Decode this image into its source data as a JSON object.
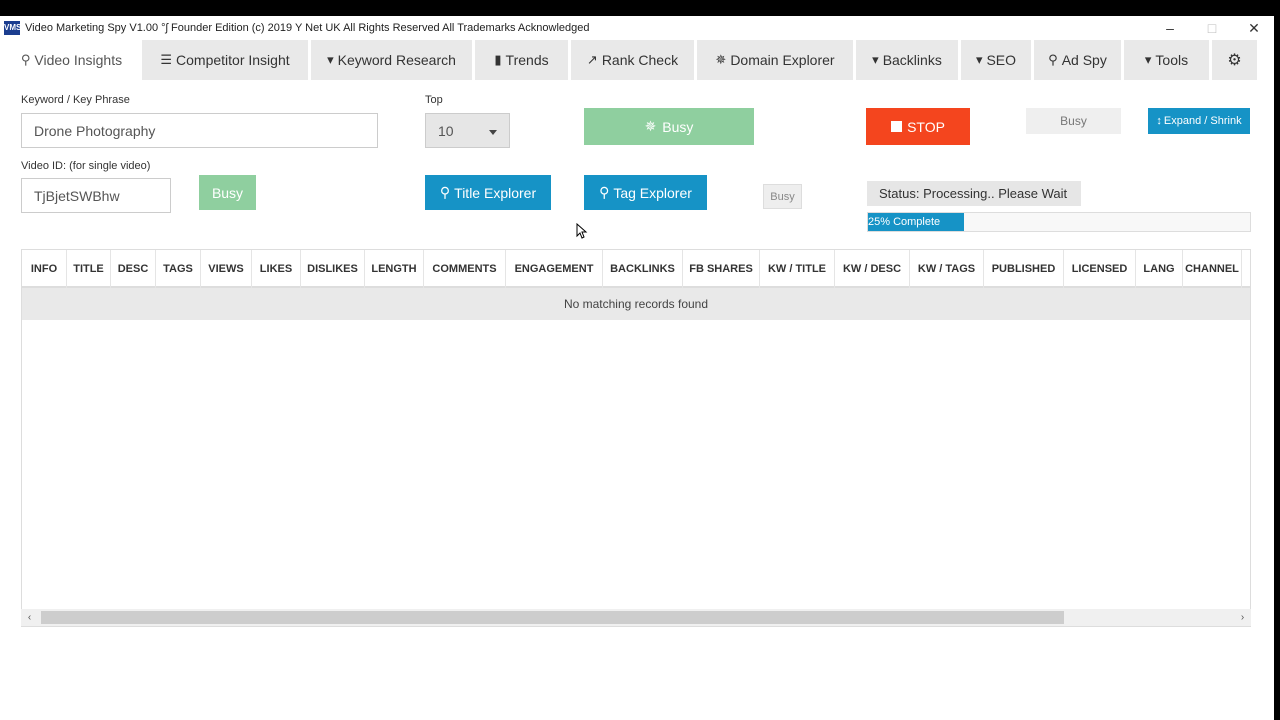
{
  "window": {
    "icon_text": "VMS",
    "title": "Video Marketing Spy V1.00   °ʃ   Founder Edition (c) 2019 Y Net UK   All Rights Reserved   All Trademarks Acknowledged",
    "minimize": "–",
    "maximize": "□",
    "close": "✕"
  },
  "tabs": [
    {
      "label": "Video Insights",
      "icon": "search-icon",
      "glyph": "⚲"
    },
    {
      "label": "Competitor Insight",
      "icon": "list-icon",
      "glyph": "☰"
    },
    {
      "label": "Keyword Research",
      "icon": "caret-icon",
      "glyph": "▾"
    },
    {
      "label": "Trends",
      "icon": "area-chart-icon",
      "glyph": "▮"
    },
    {
      "label": "Rank Check",
      "icon": "line-chart-icon",
      "glyph": "↗"
    },
    {
      "label": "Domain Explorer",
      "icon": "spinner-icon",
      "glyph": "✵"
    },
    {
      "label": "Backlinks",
      "icon": "caret-icon",
      "glyph": "▾"
    },
    {
      "label": "SEO",
      "icon": "caret-icon",
      "glyph": "▾"
    },
    {
      "label": "Ad Spy",
      "icon": "search-icon",
      "glyph": "⚲"
    },
    {
      "label": "Tools",
      "icon": "caret-icon",
      "glyph": "▾"
    },
    {
      "label": "",
      "icon": "cogs-icon",
      "glyph": "⚙"
    }
  ],
  "form": {
    "keyword_label": "Keyword / Key Phrase",
    "keyword_value": "Drone Photography",
    "top_label": "Top",
    "top_value": "10",
    "video_id_label": "Video ID: (for single video)",
    "video_id_value": "TjBjetSWBhw",
    "busy_main": "Busy",
    "busy_small_green": "Busy",
    "stop": "STOP",
    "busy_gray": "Busy",
    "expand_shrink": "Expand / Shrink",
    "title_explorer": "Title Explorer",
    "tag_explorer": "Tag Explorer",
    "busy_tiny": "Busy",
    "status": "Status: Processing.. Please Wait",
    "progress_text": "25% Complete",
    "progress_fraction": 0.25
  },
  "table": {
    "columns": [
      "INFO",
      "TITLE",
      "DESC",
      "TAGS",
      "VIEWS",
      "LIKES",
      "DISLIKES",
      "LENGTH",
      "COMMENTS",
      "ENGAGEMENT",
      "BACKLINKS",
      "FB SHARES",
      "KW / TITLE",
      "KW / DESC",
      "KW / TAGS",
      "PUBLISHED",
      "LICENSED",
      "LANG",
      "CHANNEL"
    ],
    "empty_message": "No matching records found"
  },
  "colors": {
    "primary": "#1693c6",
    "success_disabled": "#8fcf9f",
    "danger": "#f4451e"
  }
}
